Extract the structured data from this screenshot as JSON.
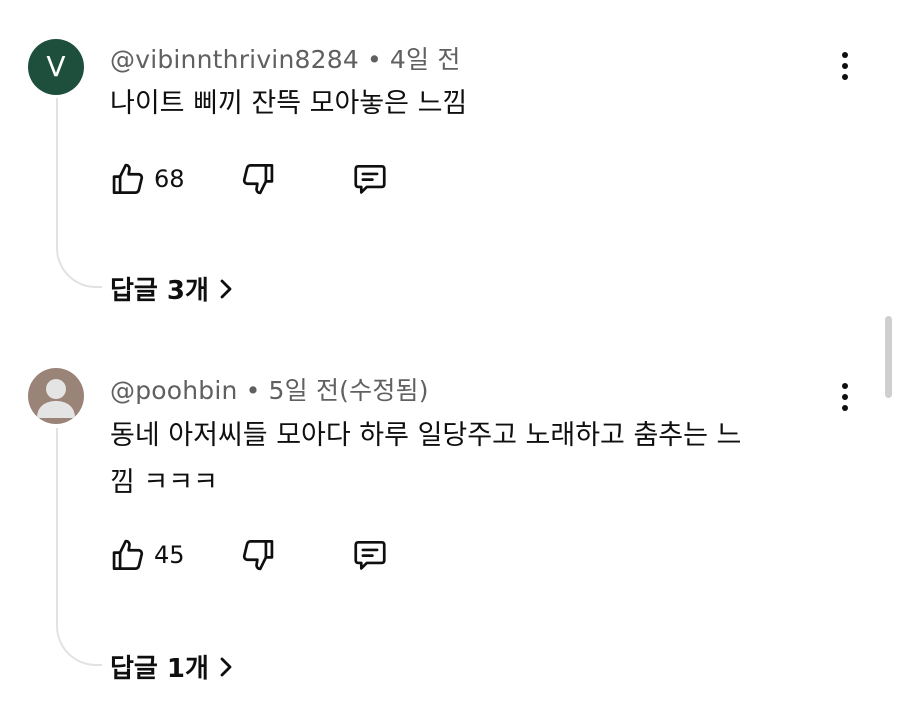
{
  "comments": [
    {
      "avatar_letter": "V",
      "author": "@vibinnthrivin8284",
      "separator": "•",
      "time": "4일 전",
      "text_lines": [
        "나이트 삐끼 잔뜩 모아놓은 느낌"
      ],
      "likes": "68",
      "replies_label": "답글 3개"
    },
    {
      "avatar_letter": "",
      "author": "@poohbin",
      "separator": "•",
      "time": "5일 전(수정됨)",
      "text_lines": [
        "동네 아저씨들 모아다 하루 일당주고 노래하고 춤추는 느",
        "낌 ㅋㅋㅋ"
      ],
      "likes": "45",
      "replies_label": "답글 1개"
    }
  ],
  "icons": {
    "like": "thumbs-up-icon",
    "dislike": "thumbs-down-icon",
    "reply": "comment-reply-icon",
    "more": "more-vertical-icon",
    "chevron": "chevron-right-icon"
  },
  "colors": {
    "avatar_green": "#1e4f3c",
    "avatar_person": "#9a8478",
    "meta_gray": "#606060",
    "thread_line": "#e2e2e2"
  }
}
